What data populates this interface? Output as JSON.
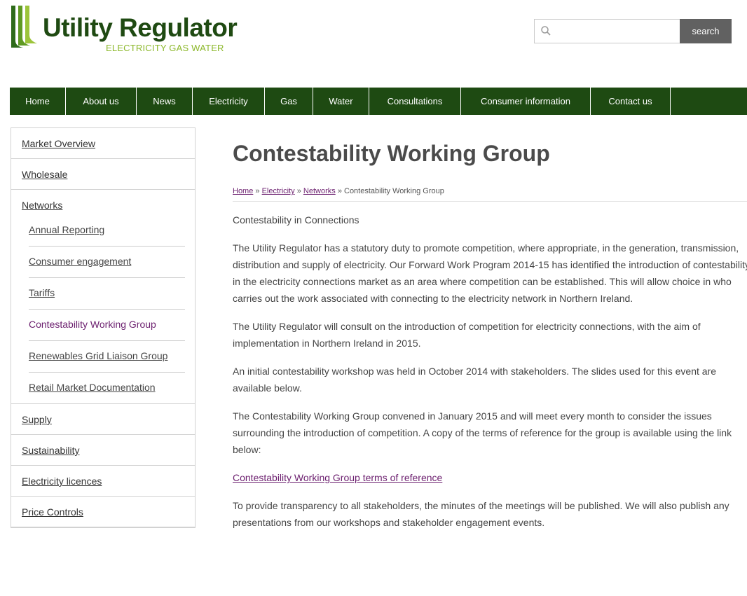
{
  "header": {
    "logo": {
      "name": "Utility Regulator",
      "tagline": "ELECTRICITY GAS WATER"
    },
    "search": {
      "placeholder": "",
      "button_label": "search",
      "icon": "search-icon"
    }
  },
  "nav": {
    "items": [
      "Home",
      "About us",
      "News",
      "Electricity",
      "Gas",
      "Water",
      "Consultations",
      "Consumer information",
      "Contact us"
    ]
  },
  "sidebar": {
    "items": [
      "Market Overview",
      "Wholesale",
      "Networks"
    ],
    "subitems": [
      "Annual Reporting",
      "Consumer engagement",
      "Tariffs",
      "Contestability Working Group",
      "Renewables Grid Liaison Group",
      "Retail Market Documentation"
    ],
    "active_subitem": "Contestability Working Group",
    "after_items": [
      "Supply",
      "Sustainability",
      "Electricity licences",
      "Price Controls"
    ]
  },
  "main": {
    "title": "Contestability Working Group",
    "breadcrumb": {
      "links": [
        "Home",
        "Electricity",
        "Networks"
      ],
      "separator": "»",
      "current": "Contestability Working Group"
    },
    "lead": "Contestability in Connections",
    "paragraphs": [
      "The Utility Regulator has a statutory duty to promote competition, where appropriate, in the generation, transmission, distribution and supply of electricity. Our Forward Work Program 2014-15 has identified the introduction of contestability in the electricity connections market as an area where competition can be established. This will allow choice in who carries out the work associated with connecting to the electricity network in Northern Ireland.",
      "The Utility Regulator will consult on the introduction of competition for electricity connections, with the aim of implementation in Northern Ireland in 2015.",
      "An initial contestability workshop was held in October 2014 with stakeholders.  The slides used for this event are available below.",
      "The Contestability Working Group convened in January 2015 and will meet every month to consider the issues surrounding the introduction of competition. A copy of the terms of reference for the group is available using the link below:"
    ],
    "terms_link": "Contestability Working Group terms of reference",
    "final_paragraph": "To provide transparency to all stakeholders, the minutes of the meetings will be published. We will also publish any presentations from our workshops and stakeholder engagement events."
  },
  "colors": {
    "nav_background": "#1e4a12",
    "logo_dark_green": "#1f4a12",
    "logo_light_green": "#8cb82b",
    "link_purple": "#6b1e6e",
    "search_button": "#616161"
  }
}
